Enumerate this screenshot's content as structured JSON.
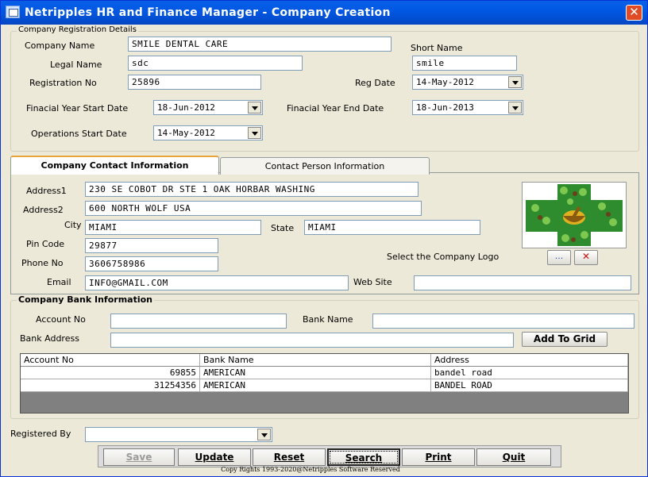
{
  "window": {
    "title": "Netripples HR and Finance Manager - Company Creation",
    "close_glyph": "✕"
  },
  "registration": {
    "group_title": "Company Registration Details",
    "company_name_label": "Company Name",
    "company_name": "SMILE DENTAL CARE",
    "short_name_label": "Short Name",
    "short_name": "smile",
    "legal_name_label": "Legal Name",
    "legal_name": "sdc",
    "registration_no_label": "Registration No",
    "registration_no": "25896",
    "reg_date_label": "Reg Date",
    "reg_date": "14-May-2012",
    "fy_start_label": "Finacial Year Start Date",
    "fy_start": "18-Jun-2012",
    "fy_end_label": "Finacial Year End Date",
    "fy_end": "18-Jun-2013",
    "ops_start_label": "Operations Start Date",
    "ops_start": "14-May-2012"
  },
  "tabs": [
    {
      "label": "Company Contact Information",
      "active": true
    },
    {
      "label": "Contact Person Information",
      "active": false
    }
  ],
  "contact": {
    "address1_label": "Address1",
    "address1": "230 SE COBOT DR STE 1 OAK HORBAR WASHING",
    "address2_label": "Address2",
    "address2": "600 NORTH WOLF USA",
    "city_label": "City",
    "city": "MIAMI",
    "state_label": "State",
    "state": "MIAMI",
    "pin_label": "Pin Code",
    "pin": "29877",
    "phone_label": "Phone No",
    "phone": "3606758986",
    "email_label": "Email",
    "email": "INFO@GMAIL.COM",
    "website_label": "Web Site",
    "website": "",
    "logo_label": "Select the Company Logo",
    "browse_label": "...",
    "clear_glyph": "✕"
  },
  "bank": {
    "group_title": "Company Bank Information",
    "account_no_label": "Account No",
    "account_no": "",
    "bank_name_label": "Bank Name",
    "bank_name": "",
    "bank_address_label": "Bank Address",
    "bank_address": "",
    "add_to_grid_label": "Add To Grid",
    "columns": [
      "Account No",
      "Bank Name",
      "Address"
    ],
    "rows": [
      [
        "69855",
        "AMERICAN",
        "bandel road"
      ],
      [
        "31254356",
        "AMERICAN",
        "BANDEL ROAD"
      ]
    ]
  },
  "registered_by_label": "Registered By",
  "registered_by": "",
  "buttons": {
    "save": "Save",
    "update": "Update",
    "reset": "Reset",
    "search": "Search",
    "print": "Print",
    "quit": "Quit"
  },
  "footer": "Copy Rights 1993-2020@Netripples Software Reserved",
  "colors": {
    "titlebar": "#0058e4",
    "close": "#e04a25",
    "window_bg": "#ece9d8",
    "logo_green": "#2e8b2e"
  }
}
